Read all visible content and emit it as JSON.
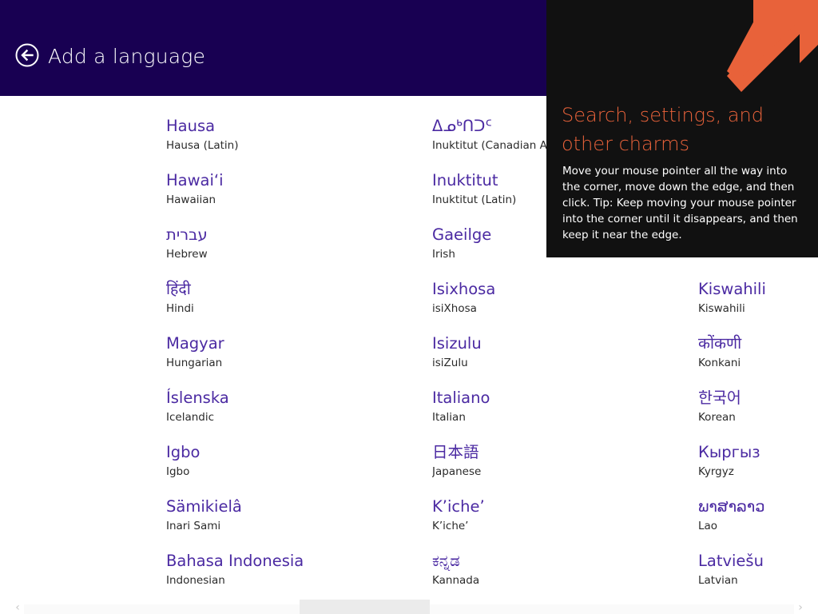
{
  "header": {
    "title": "Add a language",
    "back_icon": "back-arrow-circle-icon",
    "background": "#180052"
  },
  "languages": {
    "columns": [
      [
        {
          "native": "Hausa",
          "english": "Hausa (Latin)"
        },
        {
          "native": "Hawaiʻi",
          "english": "Hawaiian"
        },
        {
          "native": "עברית",
          "english": "Hebrew"
        },
        {
          "native": "हिंदी",
          "english": "Hindi"
        },
        {
          "native": "Magyar",
          "english": "Hungarian"
        },
        {
          "native": "Íslenska",
          "english": "Icelandic"
        },
        {
          "native": "Igbo",
          "english": "Igbo"
        },
        {
          "native": "Sämikielâ",
          "english": "Inari Sami"
        },
        {
          "native": "Bahasa Indonesia",
          "english": "Indonesian"
        }
      ],
      [
        {
          "native": "ᐃᓄᒃᑎᑐᑦ",
          "english": "Inuktitut (Canadian Ab"
        },
        {
          "native": "Inuktitut",
          "english": "Inuktitut (Latin)"
        },
        {
          "native": "Gaeilge",
          "english": "Irish"
        },
        {
          "native": "Isixhosa",
          "english": "isiXhosa"
        },
        {
          "native": "Isizulu",
          "english": "isiZulu"
        },
        {
          "native": "Italiano",
          "english": "Italian"
        },
        {
          "native": "日本語",
          "english": "Japanese"
        },
        {
          "native": "K’iche’",
          "english": "K’iche’"
        },
        {
          "native": "ಕನ್ನಡ",
          "english": "Kannada"
        }
      ],
      [
        {
          "native": "",
          "english": ""
        },
        {
          "native": "",
          "english": ""
        },
        {
          "native": "",
          "english": ""
        },
        {
          "native": "Kiswahili",
          "english": "Kiswahili"
        },
        {
          "native": "कोंकणी",
          "english": "Konkani"
        },
        {
          "native": "한국어",
          "english": "Korean"
        },
        {
          "native": "Кыргыз",
          "english": "Kyrgyz"
        },
        {
          "native": "ພາສາລາວ",
          "english": "Lao"
        },
        {
          "native": "Latviešu",
          "english": "Latvian"
        }
      ]
    ],
    "native_color": "#4b2aa2"
  },
  "charms_tip": {
    "title": "Search, settings, and other charms",
    "body": "Move your mouse pointer all the way into the corner, move down the edge, and then click. Tip: Keep moving your mouse pointer into the corner until it disappears, and then keep it near the edge.",
    "arrow_icon": "corner-arrow-icon",
    "accent": "#e8623a",
    "background": "#111111"
  },
  "scrollbar": {
    "left_icon": "chevron-left-icon",
    "right_icon": "chevron-right-icon"
  }
}
